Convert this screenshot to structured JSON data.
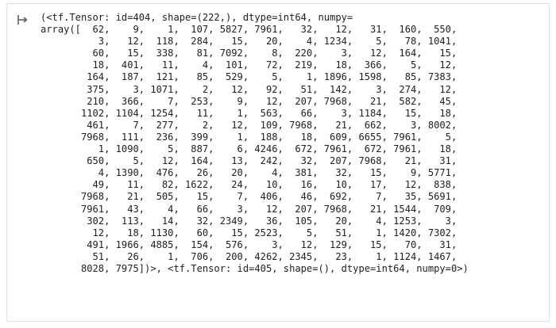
{
  "output": {
    "icon": "output-redirect-icon",
    "lines": [
      "(<tf.Tensor: id=404, shape=(222,), dtype=int64, numpy=",
      "array([  62,    9,    1,  107, 5827, 7961,   32,   12,   31,  160,  550,",
      "          3,   12,  118,  284,   15,   20,    4, 1234,    5,   78, 1041,",
      "         60,   15,  338,   81, 7092,    8,  220,    3,   12,  164,   15,",
      "         18,  401,   11,    4,  101,   72,  219,   18,  366,    5,   12,",
      "        164,  187,  121,   85,  529,    5,    1, 1896, 1598,   85, 7383,",
      "        375,    3, 1071,    2,   12,   92,   51,  142,    3,  274,   12,",
      "        210,  366,    7,  253,    9,   12,  207, 7968,   21,  582,   45,",
      "       1102, 1104, 1254,   11,    1,  563,   66,    3, 1184,   15,   18,",
      "        461,    7,  277,    2,   12,  109, 7968,   21,  662,    3, 8002,",
      "       7968,  111,  236,  399,    1,  188,   18,  609, 6655, 7961,    5,",
      "          1, 1090,    5,  887,    6, 4246,  672, 7961,  672, 7961,   18,",
      "        650,    5,   12,  164,   13,  242,   32,  207, 7968,   21,   31,",
      "          4, 1390,  476,   26,   20,    4,  381,   32,   15,    9, 5771,",
      "         49,   11,   82, 1622,   24,   10,   16,   10,   17,   12,  838,",
      "       7968,   21,  505,   15,    7,  406,   46,  692,    7,   35, 5691,",
      "       7961,   43,    4,   66,    3,   12,  207, 7968,   21, 1544,  709,",
      "        302,  113,   14,   32, 2349,   36,  105,   20,    4, 1253,    3,",
      "         12,   18, 1130,   60,   15, 2523,    5,   51,    1, 1420, 7302,",
      "        491, 1966, 4885,  154,  576,    3,   12,  129,   15,   70,   31,",
      "         51,   26,    1,  706,  200, 4262, 2345,   23,    1, 1124, 1467,",
      "       8028, 7975])>, <tf.Tensor: id=405, shape=(), dtype=int64, numpy=0>)"
    ]
  }
}
